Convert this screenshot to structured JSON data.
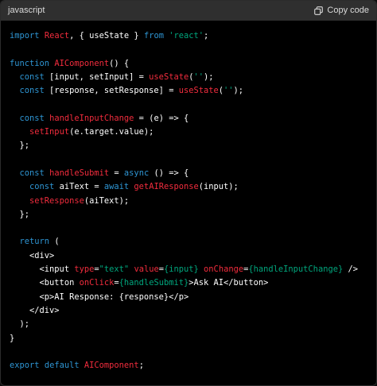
{
  "header": {
    "language": "javascript",
    "copy_label": "Copy code",
    "copy_icon": "copy-icon"
  },
  "colors": {
    "keyword": "#2e95d3",
    "function": "#f22c3d",
    "string": "#00a67d",
    "plain": "#ffffff"
  },
  "code_lines": [
    [
      [
        "kw",
        "import"
      ],
      [
        "pl",
        " "
      ],
      [
        "fn",
        "React"
      ],
      [
        "pl",
        ", { useState } "
      ],
      [
        "kw",
        "from"
      ],
      [
        "pl",
        " "
      ],
      [
        "str",
        "'react'"
      ],
      [
        "pl",
        ";"
      ]
    ],
    [],
    [
      [
        "kw",
        "function"
      ],
      [
        "pl",
        " "
      ],
      [
        "fn",
        "AIComponent"
      ],
      [
        "pl",
        "() {"
      ]
    ],
    [
      [
        "pl",
        "  "
      ],
      [
        "kw",
        "const"
      ],
      [
        "pl",
        " [input, setInput] = "
      ],
      [
        "fn",
        "useState"
      ],
      [
        "pl",
        "("
      ],
      [
        "str",
        "''"
      ],
      [
        "pl",
        ");"
      ]
    ],
    [
      [
        "pl",
        "  "
      ],
      [
        "kw",
        "const"
      ],
      [
        "pl",
        " [response, setResponse] = "
      ],
      [
        "fn",
        "useState"
      ],
      [
        "pl",
        "("
      ],
      [
        "str",
        "''"
      ],
      [
        "pl",
        ");"
      ]
    ],
    [],
    [
      [
        "pl",
        "  "
      ],
      [
        "kw",
        "const"
      ],
      [
        "pl",
        " "
      ],
      [
        "fn",
        "handleInputChange"
      ],
      [
        "pl",
        " = (e) => {"
      ]
    ],
    [
      [
        "pl",
        "    "
      ],
      [
        "fn",
        "setInput"
      ],
      [
        "pl",
        "(e.target.value);"
      ]
    ],
    [
      [
        "pl",
        "  };"
      ]
    ],
    [],
    [
      [
        "pl",
        "  "
      ],
      [
        "kw",
        "const"
      ],
      [
        "pl",
        " "
      ],
      [
        "fn",
        "handleSubmit"
      ],
      [
        "pl",
        " = "
      ],
      [
        "kw",
        "async"
      ],
      [
        "pl",
        " () => {"
      ]
    ],
    [
      [
        "pl",
        "    "
      ],
      [
        "kw",
        "const"
      ],
      [
        "pl",
        " aiText = "
      ],
      [
        "kw",
        "await"
      ],
      [
        "pl",
        " "
      ],
      [
        "fn",
        "getAIResponse"
      ],
      [
        "pl",
        "(input);"
      ]
    ],
    [
      [
        "pl",
        "    "
      ],
      [
        "fn",
        "setResponse"
      ],
      [
        "pl",
        "(aiText);"
      ]
    ],
    [
      [
        "pl",
        "  };"
      ]
    ],
    [],
    [
      [
        "pl",
        "  "
      ],
      [
        "kw",
        "return"
      ],
      [
        "pl",
        " ("
      ]
    ],
    [
      [
        "pl",
        "    <div>"
      ]
    ],
    [
      [
        "pl",
        "      <input "
      ],
      [
        "fn",
        "type"
      ],
      [
        "pl",
        "="
      ],
      [
        "str",
        "\"text\""
      ],
      [
        "pl",
        " "
      ],
      [
        "fn",
        "value"
      ],
      [
        "pl",
        "="
      ],
      [
        "str",
        "{input}"
      ],
      [
        "pl",
        " "
      ],
      [
        "fn",
        "onChange"
      ],
      [
        "pl",
        "="
      ],
      [
        "str",
        "{handleInputChange}"
      ],
      [
        "pl",
        " />"
      ]
    ],
    [
      [
        "pl",
        "      <button "
      ],
      [
        "fn",
        "onClick"
      ],
      [
        "pl",
        "="
      ],
      [
        "str",
        "{handleSubmit}"
      ],
      [
        "pl",
        ">Ask AI</button>"
      ]
    ],
    [
      [
        "pl",
        "      <p>AI Response: {response}</p>"
      ]
    ],
    [
      [
        "pl",
        "    </div>"
      ]
    ],
    [
      [
        "pl",
        "  );"
      ]
    ],
    [
      [
        "pl",
        "}"
      ]
    ],
    [],
    [
      [
        "kw",
        "export"
      ],
      [
        "pl",
        " "
      ],
      [
        "kw",
        "default"
      ],
      [
        "pl",
        " "
      ],
      [
        "fn",
        "AIComponent"
      ],
      [
        "pl",
        ";"
      ]
    ]
  ]
}
